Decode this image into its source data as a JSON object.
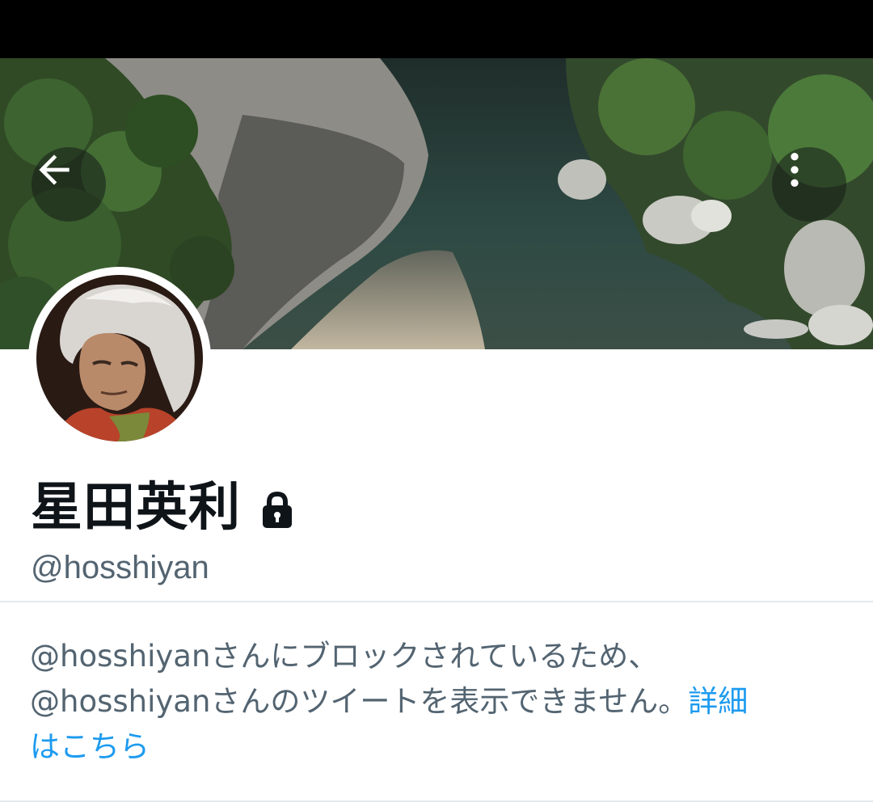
{
  "header": {
    "back_icon": "arrow-left-icon",
    "more_icon": "more-vertical-icon"
  },
  "banner": {
    "image": "river-gorge-photo"
  },
  "profile": {
    "avatar_image": "portrait-white-hair",
    "display_name": "星田英利",
    "protected_icon": "lock-icon",
    "handle": "@hosshiyan"
  },
  "notice": {
    "line1": "@hosshiyanさんにブロックされているため、",
    "line2": "@hosshiyanさんのツイートを表示できません。",
    "learn_more_part1": "詳細",
    "learn_more_part2": "はこちら"
  },
  "colors": {
    "primary_text": "#0f1419",
    "secondary_text": "#536471",
    "link": "#1d9bf0",
    "divider": "#e3e7ea"
  }
}
